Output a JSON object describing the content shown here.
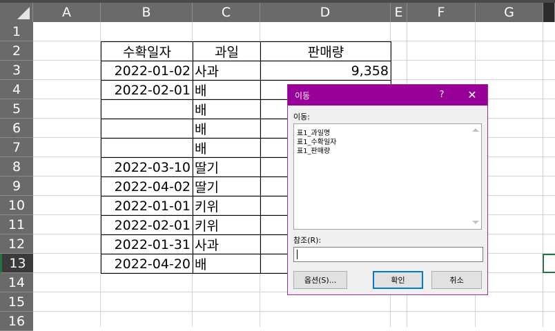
{
  "columns": [
    "A",
    "B",
    "C",
    "D",
    "E",
    "F",
    "G"
  ],
  "rows": [
    "1",
    "2",
    "3",
    "4",
    "5",
    "6",
    "7",
    "8",
    "9",
    "10",
    "11",
    "12",
    "13",
    "14",
    "15",
    "16"
  ],
  "table": {
    "headers": [
      "수확일자",
      "과일",
      "판매량"
    ],
    "rows": [
      {
        "date": "2022-01-02",
        "fruit": "사과",
        "qty": "9,358"
      },
      {
        "date": "2022-02-01",
        "fruit": "배",
        "qty": ""
      },
      {
        "date": "",
        "fruit": "배",
        "qty": ""
      },
      {
        "date": "",
        "fruit": "배",
        "qty": ""
      },
      {
        "date": "",
        "fruit": "배",
        "qty": ""
      },
      {
        "date": "2022-03-10",
        "fruit": "딸기",
        "qty": ""
      },
      {
        "date": "2022-04-02",
        "fruit": "딸기",
        "qty": ""
      },
      {
        "date": "2022-01-01",
        "fruit": "키위",
        "qty": ""
      },
      {
        "date": "2022-02-01",
        "fruit": "키위",
        "qty": ""
      },
      {
        "date": "2022-01-31",
        "fruit": "사과",
        "qty": ""
      },
      {
        "date": "2022-04-20",
        "fruit": "배",
        "qty": ""
      }
    ]
  },
  "active_row": "13",
  "dialog": {
    "title": "이동",
    "help": "?",
    "close": "✕",
    "goto_label": "이동:",
    "items": [
      "표1_과일명",
      "표1_수확일자",
      "표1_판매량"
    ],
    "reference_label": "참조(R):",
    "reference_value": "",
    "buttons": {
      "special": "옵션(S)...",
      "ok": "확인",
      "cancel": "취소"
    }
  },
  "colors": {
    "header_bg": "#6a6a6a",
    "dialog_title": "#990099",
    "select": "#217346"
  }
}
